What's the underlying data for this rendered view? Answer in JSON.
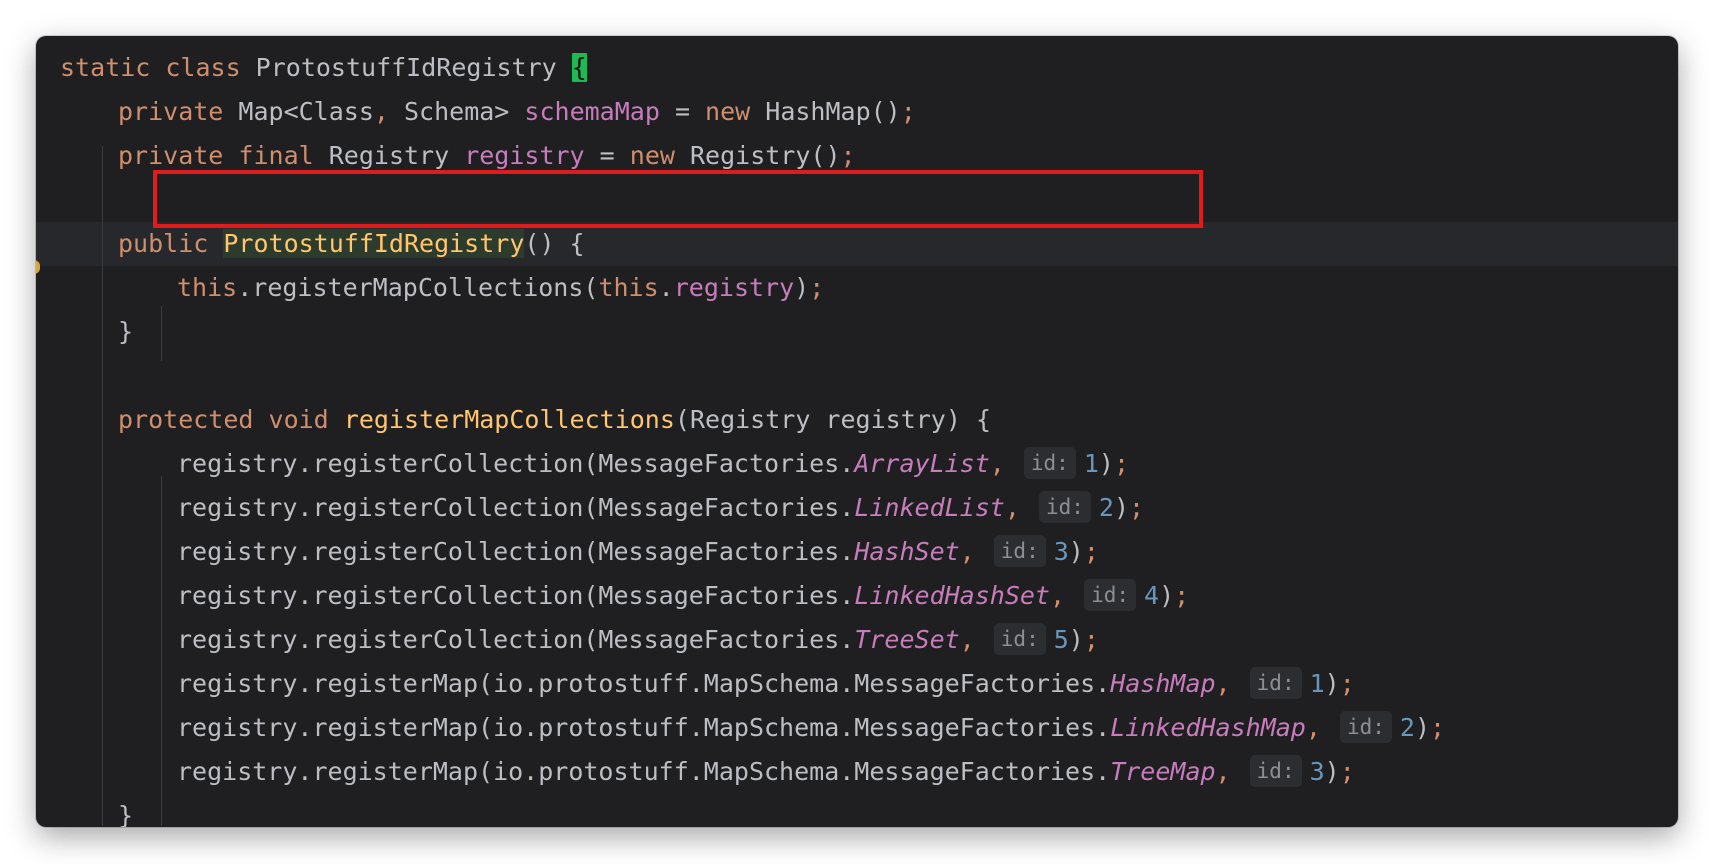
{
  "editor": {
    "lines": [
      {
        "indent": 0,
        "tokens": [
          {
            "t": "static ",
            "c": "kw"
          },
          {
            "t": "class ",
            "c": "kw"
          },
          {
            "t": "ProtostuffIdRegistry ",
            "c": ""
          },
          {
            "t": "{",
            "c": "brace-match"
          }
        ]
      },
      {
        "indent": 1,
        "tokens": [
          {
            "t": "private ",
            "c": "kw"
          },
          {
            "t": "Map<Class",
            "c": ""
          },
          {
            "t": ", ",
            "c": "kw"
          },
          {
            "t": "Schema> ",
            "c": ""
          },
          {
            "t": "schemaMap",
            "c": "fld"
          },
          {
            "t": " = ",
            "c": ""
          },
          {
            "t": "new ",
            "c": "kw"
          },
          {
            "t": "HashMap()",
            "c": ""
          },
          {
            "t": ";",
            "c": "kw"
          }
        ]
      },
      {
        "indent": 1,
        "tokens": [
          {
            "t": "private ",
            "c": "kw"
          },
          {
            "t": "final ",
            "c": "kw"
          },
          {
            "t": "Registry ",
            "c": ""
          },
          {
            "t": "registry",
            "c": "fld"
          },
          {
            "t": " = ",
            "c": ""
          },
          {
            "t": "new ",
            "c": "kw"
          },
          {
            "t": "Registry()",
            "c": ""
          },
          {
            "t": ";",
            "c": "kw"
          }
        ]
      },
      {
        "indent": 0,
        "tokens": []
      },
      {
        "indent": 1,
        "caret": true,
        "tokens": [
          {
            "t": "public ",
            "c": "kw"
          },
          {
            "t": "ProtostuffIdRegistry",
            "c": "decl ctor-hl"
          },
          {
            "t": "() {",
            "c": ""
          }
        ]
      },
      {
        "indent": 2,
        "tokens": [
          {
            "t": "this",
            "c": "kw"
          },
          {
            "t": ".registerMapCollections(",
            "c": ""
          },
          {
            "t": "this",
            "c": "kw"
          },
          {
            "t": ".",
            "c": ""
          },
          {
            "t": "registry",
            "c": "fld"
          },
          {
            "t": ")",
            "c": ""
          },
          {
            "t": ";",
            "c": "kw"
          }
        ]
      },
      {
        "indent": 1,
        "tokens": [
          {
            "t": "}",
            "c": ""
          }
        ]
      },
      {
        "indent": 0,
        "tokens": []
      },
      {
        "indent": 1,
        "tokens": [
          {
            "t": "protected ",
            "c": "kw"
          },
          {
            "t": "void ",
            "c": "kw"
          },
          {
            "t": "registerMapCollections",
            "c": "decl"
          },
          {
            "t": "(Registry registry) {",
            "c": ""
          }
        ]
      },
      {
        "indent": 2,
        "tokens": [
          {
            "t": "registry.registerCollection(MessageFactories.",
            "c": ""
          },
          {
            "t": "ArrayList",
            "c": "itf"
          },
          {
            "t": ", ",
            "c": "kw"
          },
          {
            "hint": "id:"
          },
          {
            "t": "1",
            "c": "num2"
          },
          {
            "t": ")",
            "c": ""
          },
          {
            "t": ";",
            "c": "kw"
          }
        ]
      },
      {
        "indent": 2,
        "tokens": [
          {
            "t": "registry.registerCollection(MessageFactories.",
            "c": ""
          },
          {
            "t": "LinkedList",
            "c": "itf"
          },
          {
            "t": ", ",
            "c": "kw"
          },
          {
            "hint": "id:"
          },
          {
            "t": "2",
            "c": "num2"
          },
          {
            "t": ")",
            "c": ""
          },
          {
            "t": ";",
            "c": "kw"
          }
        ]
      },
      {
        "indent": 2,
        "tokens": [
          {
            "t": "registry.registerCollection(MessageFactories.",
            "c": ""
          },
          {
            "t": "HashSet",
            "c": "itf"
          },
          {
            "t": ", ",
            "c": "kw"
          },
          {
            "hint": "id:"
          },
          {
            "t": "3",
            "c": "num2"
          },
          {
            "t": ")",
            "c": ""
          },
          {
            "t": ";",
            "c": "kw"
          }
        ]
      },
      {
        "indent": 2,
        "tokens": [
          {
            "t": "registry.registerCollection(MessageFactories.",
            "c": ""
          },
          {
            "t": "LinkedHashSet",
            "c": "itf"
          },
          {
            "t": ", ",
            "c": "kw"
          },
          {
            "hint": "id:"
          },
          {
            "t": "4",
            "c": "num2"
          },
          {
            "t": ")",
            "c": ""
          },
          {
            "t": ";",
            "c": "kw"
          }
        ]
      },
      {
        "indent": 2,
        "tokens": [
          {
            "t": "registry.registerCollection(MessageFactories.",
            "c": ""
          },
          {
            "t": "TreeSet",
            "c": "itf"
          },
          {
            "t": ", ",
            "c": "kw"
          },
          {
            "hint": "id:"
          },
          {
            "t": "5",
            "c": "num2"
          },
          {
            "t": ")",
            "c": ""
          },
          {
            "t": ";",
            "c": "kw"
          }
        ]
      },
      {
        "indent": 2,
        "tokens": [
          {
            "t": "registry.registerMap(io.protostuff.MapSchema.MessageFactories.",
            "c": ""
          },
          {
            "t": "HashMap",
            "c": "itf"
          },
          {
            "t": ", ",
            "c": "kw"
          },
          {
            "hint": "id:"
          },
          {
            "t": "1",
            "c": "num2"
          },
          {
            "t": ")",
            "c": ""
          },
          {
            "t": ";",
            "c": "kw"
          }
        ]
      },
      {
        "indent": 2,
        "tokens": [
          {
            "t": "registry.registerMap(io.protostuff.MapSchema.MessageFactories.",
            "c": ""
          },
          {
            "t": "LinkedHashMap",
            "c": "itf"
          },
          {
            "t": ", ",
            "c": "kw"
          },
          {
            "hint": "id:"
          },
          {
            "t": "2",
            "c": "num2"
          },
          {
            "t": ")",
            "c": ""
          },
          {
            "t": ";",
            "c": "kw"
          }
        ]
      },
      {
        "indent": 2,
        "tokens": [
          {
            "t": "registry.registerMap(io.protostuff.MapSchema.MessageFactories.",
            "c": ""
          },
          {
            "t": "TreeMap",
            "c": "itf"
          },
          {
            "t": ", ",
            "c": "kw"
          },
          {
            "hint": "id:"
          },
          {
            "t": "3",
            "c": "num2"
          },
          {
            "t": ")",
            "c": ""
          },
          {
            "t": ";",
            "c": "kw"
          }
        ]
      },
      {
        "indent": 1,
        "tokens": [
          {
            "t": "}",
            "c": ""
          }
        ]
      }
    ],
    "highlight": {
      "color": "#e01b1b",
      "line": 3
    }
  },
  "colors": {
    "background": "#1f1f21",
    "keyword": "#cf8e6d",
    "field": "#c77dbb",
    "declaration": "#ffc66d",
    "number": "#6897bb",
    "text": "#bcbec4"
  }
}
